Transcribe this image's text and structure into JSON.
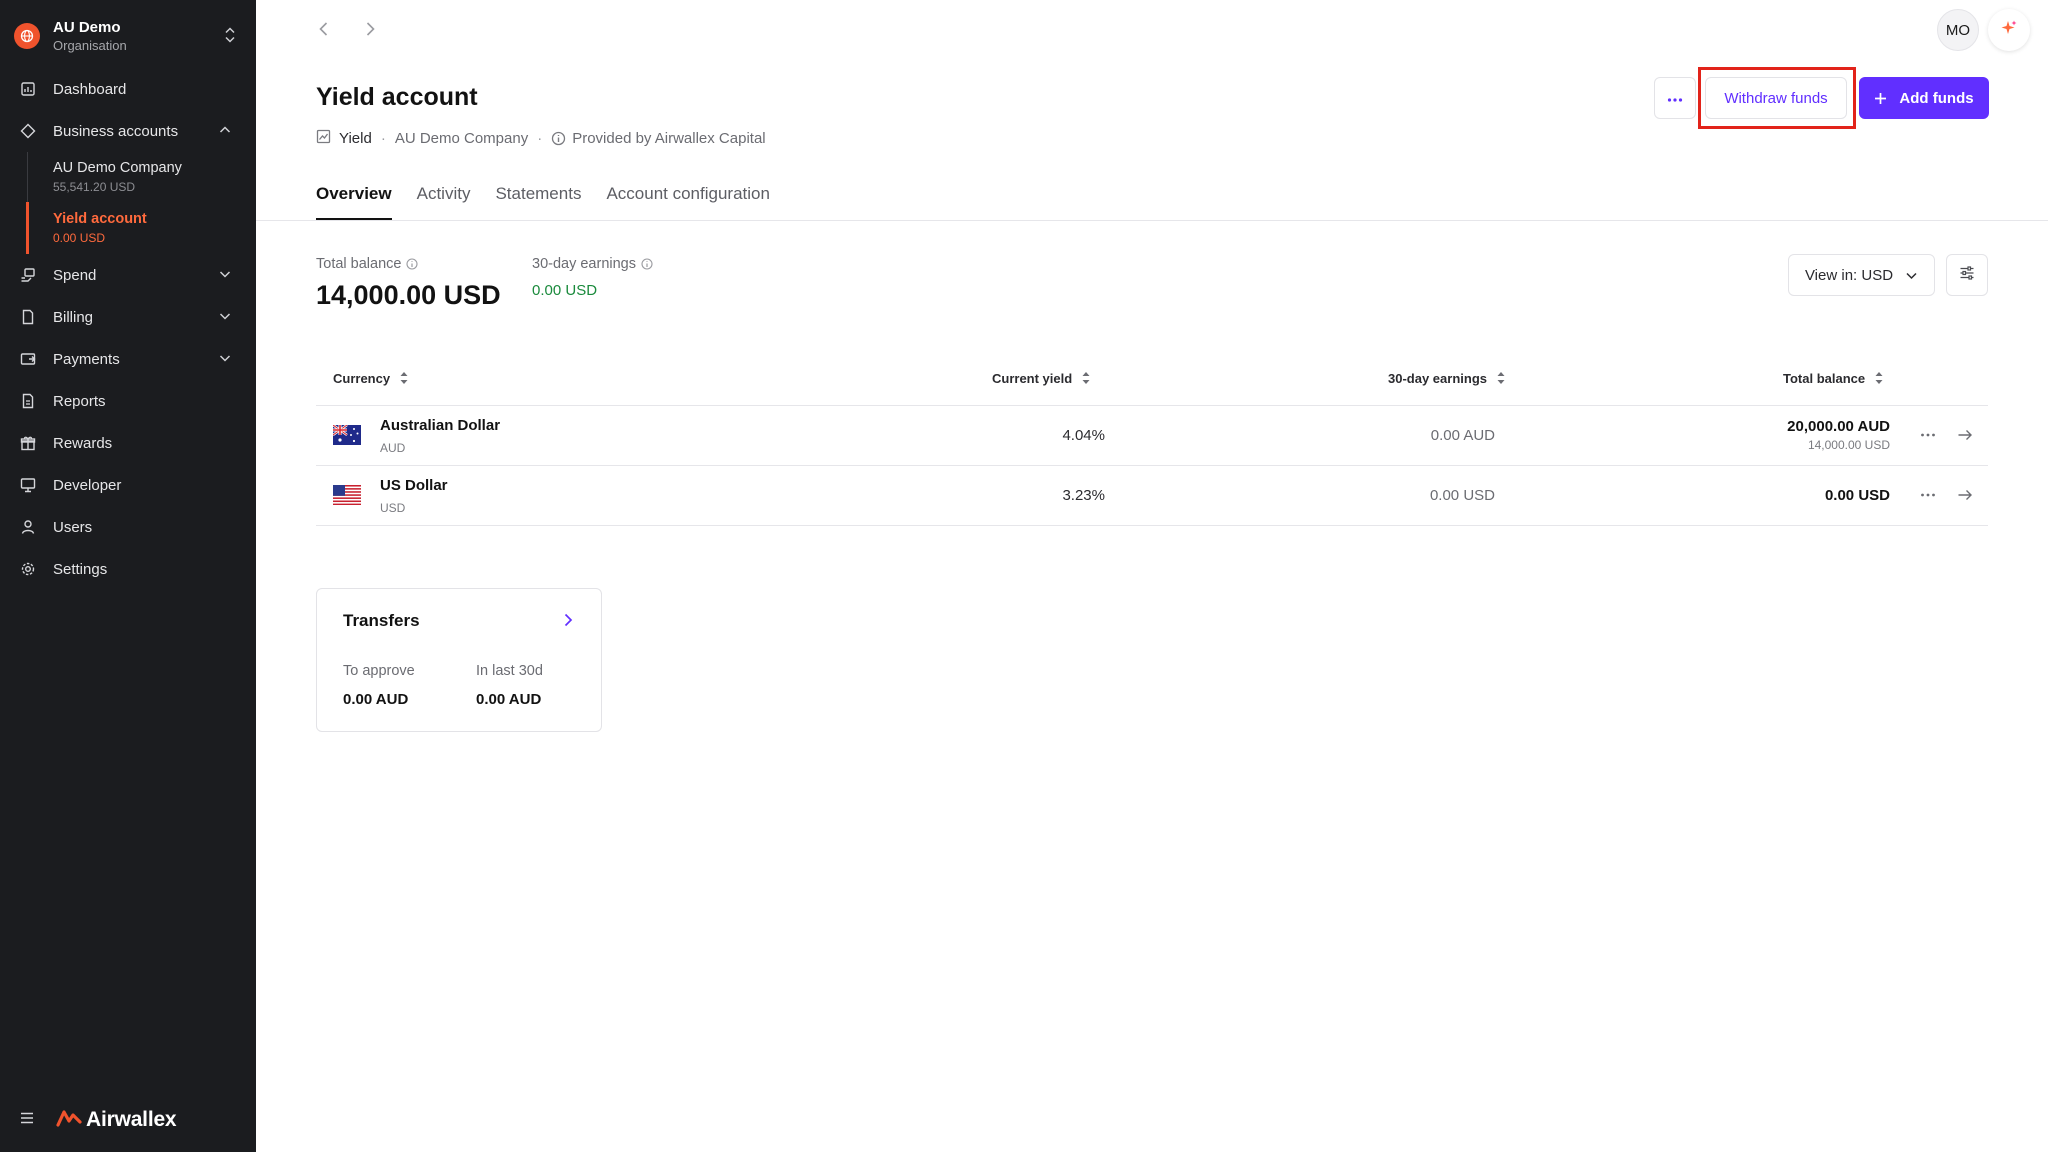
{
  "org": {
    "name": "AU Demo",
    "subtitle": "Organisation"
  },
  "nav": {
    "dashboard": "Dashboard",
    "business_accounts": "Business accounts",
    "accounts": [
      {
        "name": "AU Demo Company",
        "value": "55,541.20 USD"
      },
      {
        "name": "Yield account",
        "value": "0.00 USD"
      }
    ],
    "spend": "Spend",
    "billing": "Billing",
    "payments": "Payments",
    "reports": "Reports",
    "rewards": "Rewards",
    "developer": "Developer",
    "users": "Users",
    "settings": "Settings"
  },
  "brand": {
    "name": "Airwallex",
    "accent": "#f0532d"
  },
  "header": {
    "avatar_initials": "MO"
  },
  "page": {
    "title": "Yield account",
    "meta_type": "Yield",
    "meta_company": "AU Demo Company",
    "meta_provider": "Provided by Airwallex Capital"
  },
  "actions": {
    "withdraw": "Withdraw funds",
    "add": "Add funds",
    "primary_color": "#612fff",
    "highlight_color": "#e2231a"
  },
  "tabs": [
    "Overview",
    "Activity",
    "Statements",
    "Account configuration"
  ],
  "summary": {
    "total_balance_label": "Total balance",
    "total_balance": "14,000.00 USD",
    "earnings_label": "30-day earnings",
    "earnings": "0.00 USD",
    "view_in": "View in: USD"
  },
  "table": {
    "headers": [
      "Currency",
      "Current yield",
      "30-day earnings",
      "Total balance"
    ],
    "rows": [
      {
        "name": "Australian Dollar",
        "code": "AUD",
        "yield": "4.04%",
        "earnings": "0.00 AUD",
        "balance": "20,000.00 AUD",
        "balance_converted": "14,000.00 USD"
      },
      {
        "name": "US Dollar",
        "code": "USD",
        "yield": "3.23%",
        "earnings": "0.00 USD",
        "balance": "0.00 USD",
        "balance_converted": ""
      }
    ]
  },
  "transfers": {
    "title": "Transfers",
    "to_approve_label": "To approve",
    "to_approve": "0.00 AUD",
    "last30_label": "In last 30d",
    "last30": "0.00 AUD"
  }
}
